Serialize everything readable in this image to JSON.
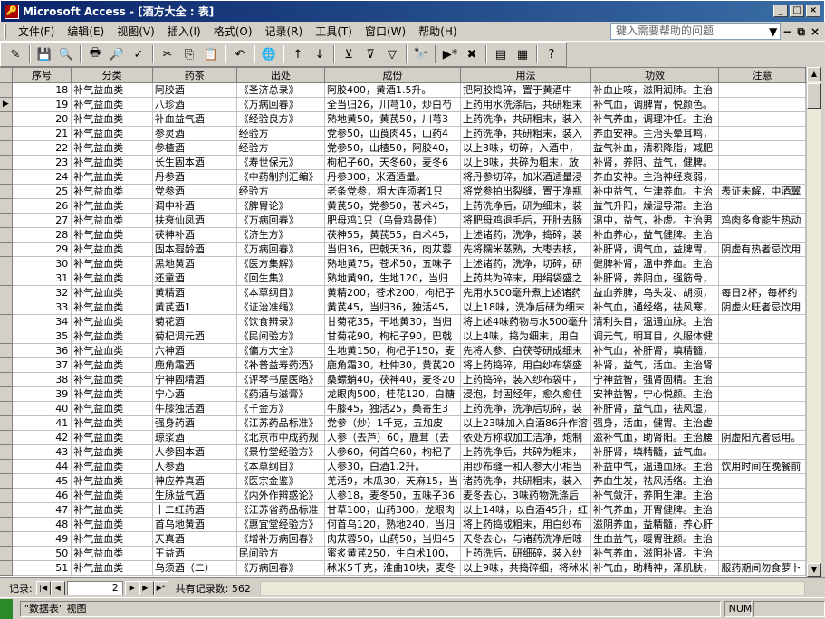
{
  "window": {
    "title": "Microsoft Access - [酒方大全 : 表]"
  },
  "menu": [
    "文件(F)",
    "编辑(E)",
    "视图(V)",
    "插入(I)",
    "格式(O)",
    "记录(R)",
    "工具(T)",
    "窗口(W)",
    "帮助(H)"
  ],
  "help_placeholder": "键入需要帮助的问题",
  "columns": [
    "序号",
    "分类",
    "药茶",
    "出处",
    "成份",
    "用法",
    "功效",
    "注意"
  ],
  "rows": [
    [
      "18",
      "补气益血类",
      "阿胶酒",
      "《圣济总录》",
      "阿胶400，黄酒1.5升。",
      "把阿胶捣碎，置于黄酒中",
      "补血止咳，滋阴润肺。主治",
      ""
    ],
    [
      "19",
      "补气益血类",
      "八珍酒",
      "《万病回春》",
      "全当归26，川芎10，炒白芍",
      "上药用水洗涤后，共研粗末",
      "补气血，调脾胃，悦颜色。",
      ""
    ],
    [
      "20",
      "补气益血类",
      "补血益气酒",
      "《经验良方》",
      "熟地黄50，黄芪50，川芎3",
      "上药洗净，共研粗末，装入",
      "补气养血，调理冲任。主治",
      ""
    ],
    [
      "21",
      "补气益血类",
      "参灵酒",
      "经验方",
      "党参50，山莨肉45，山药4",
      "上药洗净，共研粗末，装入",
      "养血安神。主治头晕耳鸣，",
      ""
    ],
    [
      "22",
      "补气益血类",
      "参楂酒",
      "经验方",
      "党参50，山楂50，阿胶40，",
      "以上3味，切碎，入酒中，",
      "益气补血，清积降脂，减肥",
      ""
    ],
    [
      "23",
      "补气益血类",
      "长生固本酒",
      "《寿世保元》",
      "枸杞子60，天冬60，麦冬6",
      "以上8味，共碎为粗末，放",
      "补肾，养阴、益气，健脾。",
      ""
    ],
    [
      "24",
      "补气益血类",
      "丹参酒",
      "《中药制剂汇编》",
      "丹参300，米酒适量。",
      "将丹参切碎，加米酒适量浸",
      "养血安神。主治神经衰弱，",
      ""
    ],
    [
      "25",
      "补气益血类",
      "党参酒",
      "经验方",
      "老条党参，粗大连须者1只",
      "将党参拍出裂缝，置于净瓶",
      "补中益气，生津养血。主治",
      "表证未解，中酒翼"
    ],
    [
      "26",
      "补气益血类",
      "调中补酒",
      "《脾胃论》",
      "黄芪50，党参50，苍术45，",
      "上药洗净后，研为细末，装",
      "益气升阳，燥湿导滞。主治",
      ""
    ],
    [
      "27",
      "补气益血类",
      "扶衰仙凤酒",
      "《万病回春》",
      "肥母鸡1只（乌骨鸡最佳）",
      "将肥母鸡退毛后，开肚去肠",
      "温中，益气，补虚。主治男",
      "鸡肉多食能生热动"
    ],
    [
      "28",
      "补气益血类",
      "茯神补酒",
      "《济生方》",
      "茯神55，黄芪55，白术45，",
      "上述诸药，洗净，捣碎，装",
      "补血养心，益气健脾。主治",
      ""
    ],
    [
      "29",
      "补气益血类",
      "固本遐龄酒",
      "《万病回春》",
      "当归36，巴戟天36，肉苁蓉",
      "先将糯米蒸熟，大枣去核，",
      "补肝肾，调气血，益脾胃，",
      "阴虚有热者忌饮用"
    ],
    [
      "30",
      "补气益血类",
      "黑地黄酒",
      "《医方集解》",
      "熟地黄75，苍术50，五味子",
      "上述诸药，洗净，切碎，研",
      "健脾补肾，温中养血。主治",
      ""
    ],
    [
      "31",
      "补气益血类",
      "还童酒",
      "《回生集》",
      "熟地黄90，生地120，当归",
      "上药共为碎末，用绢袋盛之",
      "补肝肾，养阴血，强筋骨，",
      ""
    ],
    [
      "32",
      "补气益血类",
      "黄精酒",
      "《本草纲目》",
      "黄精200，苍术200，枸杞子",
      "先用水500毫升煮上述诸药",
      "益血养脾，乌头发、胡须，",
      "每日2杯，每杯约"
    ],
    [
      "33",
      "补气益血类",
      "黄芪酒1",
      "《证治准绳》",
      "黄芪45，当归36，独活45，",
      "以上18味，洗净后研为细末",
      "补气血，通经络，祛风寒，",
      "阴虚火旺者忌饮用"
    ],
    [
      "34",
      "补气益血类",
      "菊花酒",
      "《饮食辨录》",
      "甘菊花35，干地黄30，当归",
      "将上述4味药物与水500毫升",
      "清利头目，温通血脉。主治",
      ""
    ],
    [
      "35",
      "补气益血类",
      "菊杞调元酒",
      "《民间验方》",
      "甘菊花90，枸杞子90，巴戟",
      "以上4味，捣为细末，用白",
      "调元气，明耳目，久服体健",
      ""
    ],
    [
      "36",
      "补气益血类",
      "六神酒",
      "《偏方大全》",
      "生地黄150，枸杞子150，麦",
      "先将人参、白茯苓研成细末",
      "补气血，补肝肾，填精髓，",
      ""
    ],
    [
      "37",
      "补气益血类",
      "鹿角霜酒",
      "《补普益寿药酒》",
      "鹿角霜30，杜仲30，黄芪20",
      "将上药捣碎，用白纱布袋盛",
      "补肾，益气，活血。主治肾",
      ""
    ],
    [
      "38",
      "补气益血类",
      "宁神固精酒",
      "《评琴书屋医略》",
      "桑螵蛸40，茯神40，麦冬20",
      "上药捣碎，装入纱布袋中，",
      "宁神益智，强肾固精。主治",
      ""
    ],
    [
      "39",
      "补气益血类",
      "宁心酒",
      "《药酒与滋膏》",
      "龙眼肉500，桂花120，白糖",
      "浸泡，封固经年，愈久愈佳",
      "安神益智，宁心悦颜。主治",
      ""
    ],
    [
      "40",
      "补气益血类",
      "牛膝独活酒",
      "《千金方》",
      "牛膝45，独活25，桑寄生3",
      "上药洗净，洗净后切碎，装",
      "补肝肾，益气血，祛风湿，",
      ""
    ],
    [
      "41",
      "补气益血类",
      "强身药酒",
      "《江苏药品标准》",
      "党参（炒）1千克，五加皮",
      "以上23味加入白酒86升作溶",
      "强身，活血，健胃。主治虚",
      ""
    ],
    [
      "42",
      "补气益血类",
      "琼浆酒",
      "《北京市中成药规",
      "人参（去芦）60，鹿茸（去",
      "依处方称取加工洁净，炮制",
      "滋补气血，助肾阳。主治腰",
      "阴虚阳亢者忌用。"
    ],
    [
      "43",
      "补气益血类",
      "人参固本酒",
      "《景竹堂经验方》",
      "人参60，何首乌60，枸杞子",
      "上药洗净后，共碎为粗末，",
      "补肝肾，填精髓，益气血。",
      ""
    ],
    [
      "44",
      "补气益血类",
      "人参酒",
      "《本草纲目》",
      "人参30，白酒1.2升。",
      "用纱布缝一和人参大小相当",
      "补益中气，温通血脉。主治",
      "饮用时间在晚餐前"
    ],
    [
      "45",
      "补气益血类",
      "神应养真酒",
      "《医宗金鉴》",
      "羌活9，木瓜30，天麻15，当",
      "诸药洗净，共研粗末，装入",
      "养血生发，祛风活络。主治",
      ""
    ],
    [
      "46",
      "补气益血类",
      "生脉益气酒",
      "《内外作辨惑论》",
      "人参18，麦冬50，五味子36",
      "麦冬去心，3味药物洗涤后",
      "补气敛汗，养阴生津。主治",
      ""
    ],
    [
      "47",
      "补气益血类",
      "十二红药酒",
      "《江苏省药品标准",
      "甘草100，山药300，龙眼肉",
      "以上14味，以白酒45升，红",
      "补气养血，开胃健脾。主治",
      ""
    ],
    [
      "48",
      "补气益血类",
      "首乌地黄酒",
      "《惠宜堂经验方》",
      "何首乌120，熟地240，当归",
      "将上药捣成粗末，用白纱布",
      "滋阴养血，益精髓，养心肝",
      ""
    ],
    [
      "49",
      "补气益血类",
      "天真酒",
      "《增补万病回春》",
      "肉苁蓉50，山药50，当归45",
      "天冬去心，与诸药洗净后晾",
      "生血益气，暖胃驻颜。主治",
      ""
    ],
    [
      "50",
      "补气益血类",
      "王益酒",
      "民间验方",
      "蜜炙黄芪250，生白术100，",
      "上药洗后，研细碎，装入纱",
      "补气养血，滋阴补肾。主治",
      ""
    ],
    [
      "51",
      "补气益血类",
      "乌须酒（二）",
      "《万病回春》",
      "秫米5千克，淮曲10块，麦冬",
      "以上9味，共捣碎细，将秫米",
      "补气血，助精神，泽肌肤，",
      "服药期间勿食萝卜"
    ]
  ],
  "nav": {
    "label": "记录:",
    "current": "2",
    "total_text": "共有记录数: 562"
  },
  "status": {
    "text": "\"数据表\" 视图",
    "num": "NUM"
  }
}
